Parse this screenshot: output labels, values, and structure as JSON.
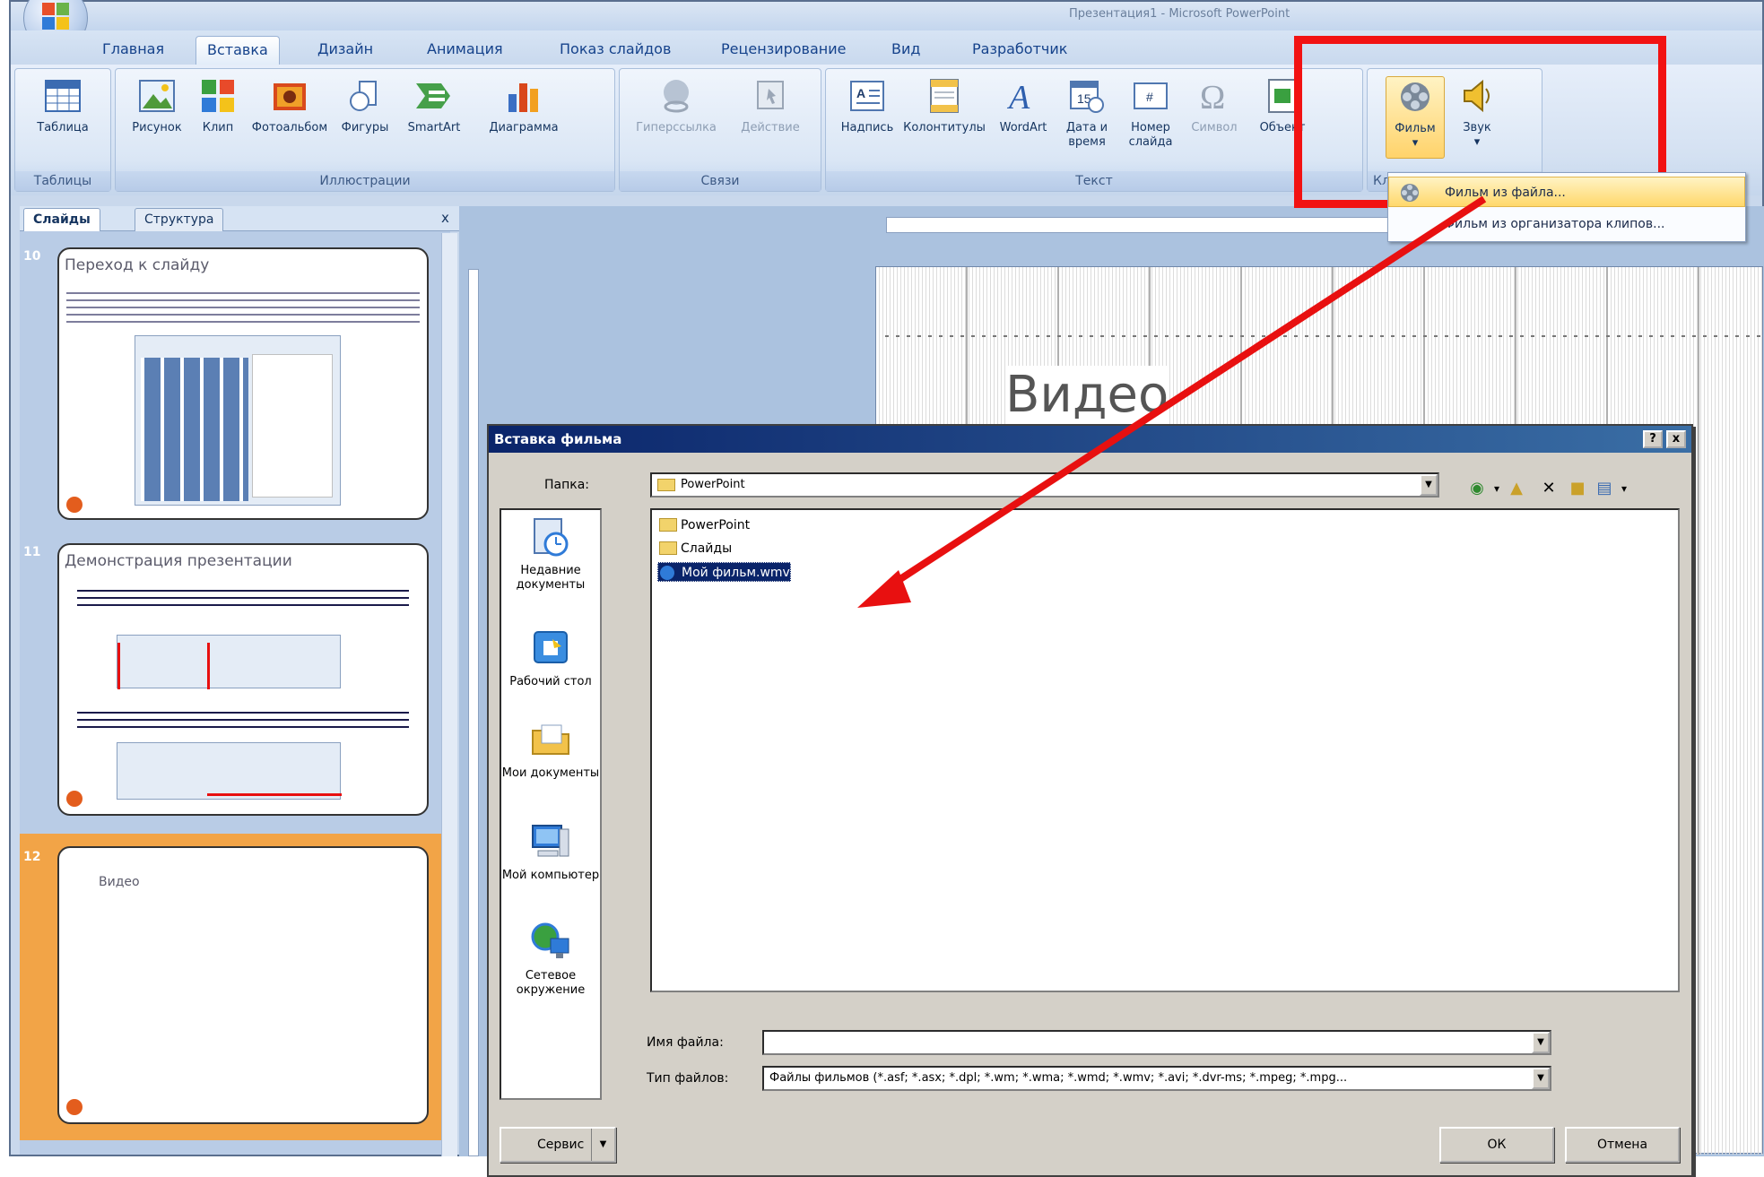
{
  "app": {
    "title": "Презентация1 - Microsoft PowerPoint"
  },
  "ribbon": {
    "tabs": [
      "Главная",
      "Вставка",
      "Дизайн",
      "Анимация",
      "Показ слайдов",
      "Рецензирование",
      "Вид",
      "Разработчик"
    ],
    "active_tab": "Вставка",
    "groups": {
      "tables": {
        "label": "Таблицы",
        "buttons": [
          "Таблица"
        ]
      },
      "illustrations": {
        "label": "Иллюстрации",
        "buttons": [
          "Рисунок",
          "Клип",
          "Фотоальбом",
          "Фигуры",
          "SmartArt",
          "Диаграмма"
        ]
      },
      "links": {
        "label": "Связи",
        "buttons": [
          "Гиперссылка",
          "Действие"
        ]
      },
      "text": {
        "label": "Текст",
        "buttons": [
          "Надпись",
          "Колонтитулы",
          "WordArt",
          "Дата и время",
          "Номер слайда",
          "Символ",
          "Объект"
        ]
      },
      "media": {
        "label": "Кл",
        "buttons": [
          "Фильм",
          "Звук"
        ]
      }
    },
    "movie_menu": {
      "item_from_file": "Фильм из файла...",
      "item_from_organizer": "Фильм из организатора клипов..."
    },
    "icons": {
      "tables": [
        "table-icon"
      ],
      "illustrations": [
        "picture-icon",
        "clipart-icon",
        "photo-album-icon",
        "shapes-icon",
        "smartart-icon",
        "chart-icon"
      ],
      "links": [
        "hyperlink-icon",
        "action-icon"
      ],
      "text": [
        "textbox-icon",
        "header-footer-icon",
        "wordart-icon",
        "date-time-icon",
        "slide-number-icon",
        "symbol-icon",
        "object-icon"
      ],
      "media": [
        "film-reel-icon",
        "speaker-icon"
      ]
    }
  },
  "panel": {
    "tabs": [
      "Слайды",
      "Структура"
    ],
    "close": "x",
    "slides": [
      {
        "number": "10",
        "title": "Переход к слайду"
      },
      {
        "number": "11",
        "title": "Демонстрация презентации"
      },
      {
        "number": "12",
        "title": "Видео"
      }
    ]
  },
  "slide": {
    "title": "Видео"
  },
  "dialog": {
    "title": "Вставка фильма",
    "help_btn": "?",
    "close_btn": "x",
    "folder_label": "Папка:",
    "folder_value": "PowerPoint",
    "places": [
      "Недавние документы",
      "Рабочий стол",
      "Мои документы",
      "Мой компьютер",
      "Сетевое окружение"
    ],
    "files": [
      "PowerPoint",
      "Слайды",
      "Мой фильм.wmv"
    ],
    "filename_label": "Имя файла:",
    "filename_value": "",
    "filetype_label": "Тип файлов:",
    "filetype_value": "Файлы фильмов (*.asf; *.asx; *.dpl; *.wm; *.wma; *.wmd; *.wmv; *.avi; *.dvr-ms; *.mpeg; *.mpg...",
    "service_btn": "Сервис",
    "ok_btn": "ОК",
    "cancel_btn": "Отмена"
  },
  "colors": {
    "highlight": "#f21212",
    "arrow": "#e81010",
    "dialog_title": "#0a246a",
    "selected_slide": "#f2a447"
  }
}
